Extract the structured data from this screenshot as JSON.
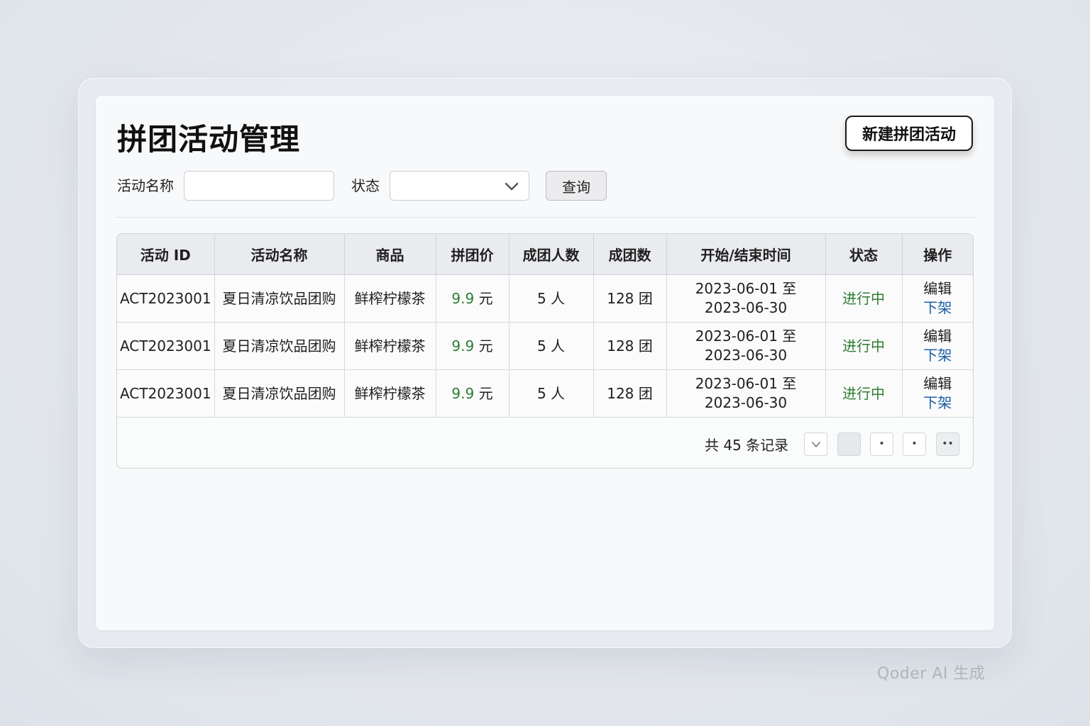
{
  "header": {
    "title": "拼团活动管理",
    "new_button_label": "新建拼团活动"
  },
  "filters": {
    "name_label": "活动名称",
    "name_value": "",
    "status_label": "状态",
    "status_value": "",
    "query_label": "查询"
  },
  "table": {
    "columns": [
      "活动 ID",
      "活动名称",
      "商品",
      "拼团价",
      "成团人数",
      "成团数",
      "开始/结束时间",
      "状态",
      "操作"
    ],
    "rows": [
      {
        "id": "ACT2023001",
        "name": "夏日清凉饮品团购",
        "product": "鲜榨柠檬茶",
        "price_num": "9.9",
        "price_unit": " 元",
        "group_size": "5 人",
        "group_count": "128 团",
        "time_start": "2023-06-01 至",
        "time_end": "2023-06-30",
        "status": "进行中",
        "op_edit": "编辑",
        "op_off": "下架"
      },
      {
        "id": "ACT2023001",
        "name": "夏日清凉饮品团购",
        "product": "鲜榨柠檬茶",
        "price_num": "9.9",
        "price_unit": " 元",
        "group_size": "5 人",
        "group_count": "128 团",
        "time_start": "2023-06-01 至",
        "time_end": "2023-06-30",
        "status": "进行中",
        "op_edit": "编辑",
        "op_off": "下架"
      },
      {
        "id": "ACT2023001",
        "name": "夏日清凉饮品团购",
        "product": "鲜榨柠檬茶",
        "price_num": "9.9",
        "price_unit": " 元",
        "group_size": "5 人",
        "group_count": "128 团",
        "time_start": "2023-06-01 至",
        "time_end": "2023-06-30",
        "status": "进行中",
        "op_edit": "编辑",
        "op_off": "下架"
      }
    ]
  },
  "pagination": {
    "total_text": "共 45 条记录",
    "buttons": [
      "",
      "",
      "•",
      "•",
      "••"
    ]
  },
  "watermark": "Qoder AI 生成",
  "colors": {
    "price": "#2e7d32",
    "status_active": "#2e7d32",
    "link": "#1f5fa8"
  },
  "icons": {
    "select_chevron": "chevron-down-icon",
    "pager_prev": "chevron-down-icon"
  }
}
